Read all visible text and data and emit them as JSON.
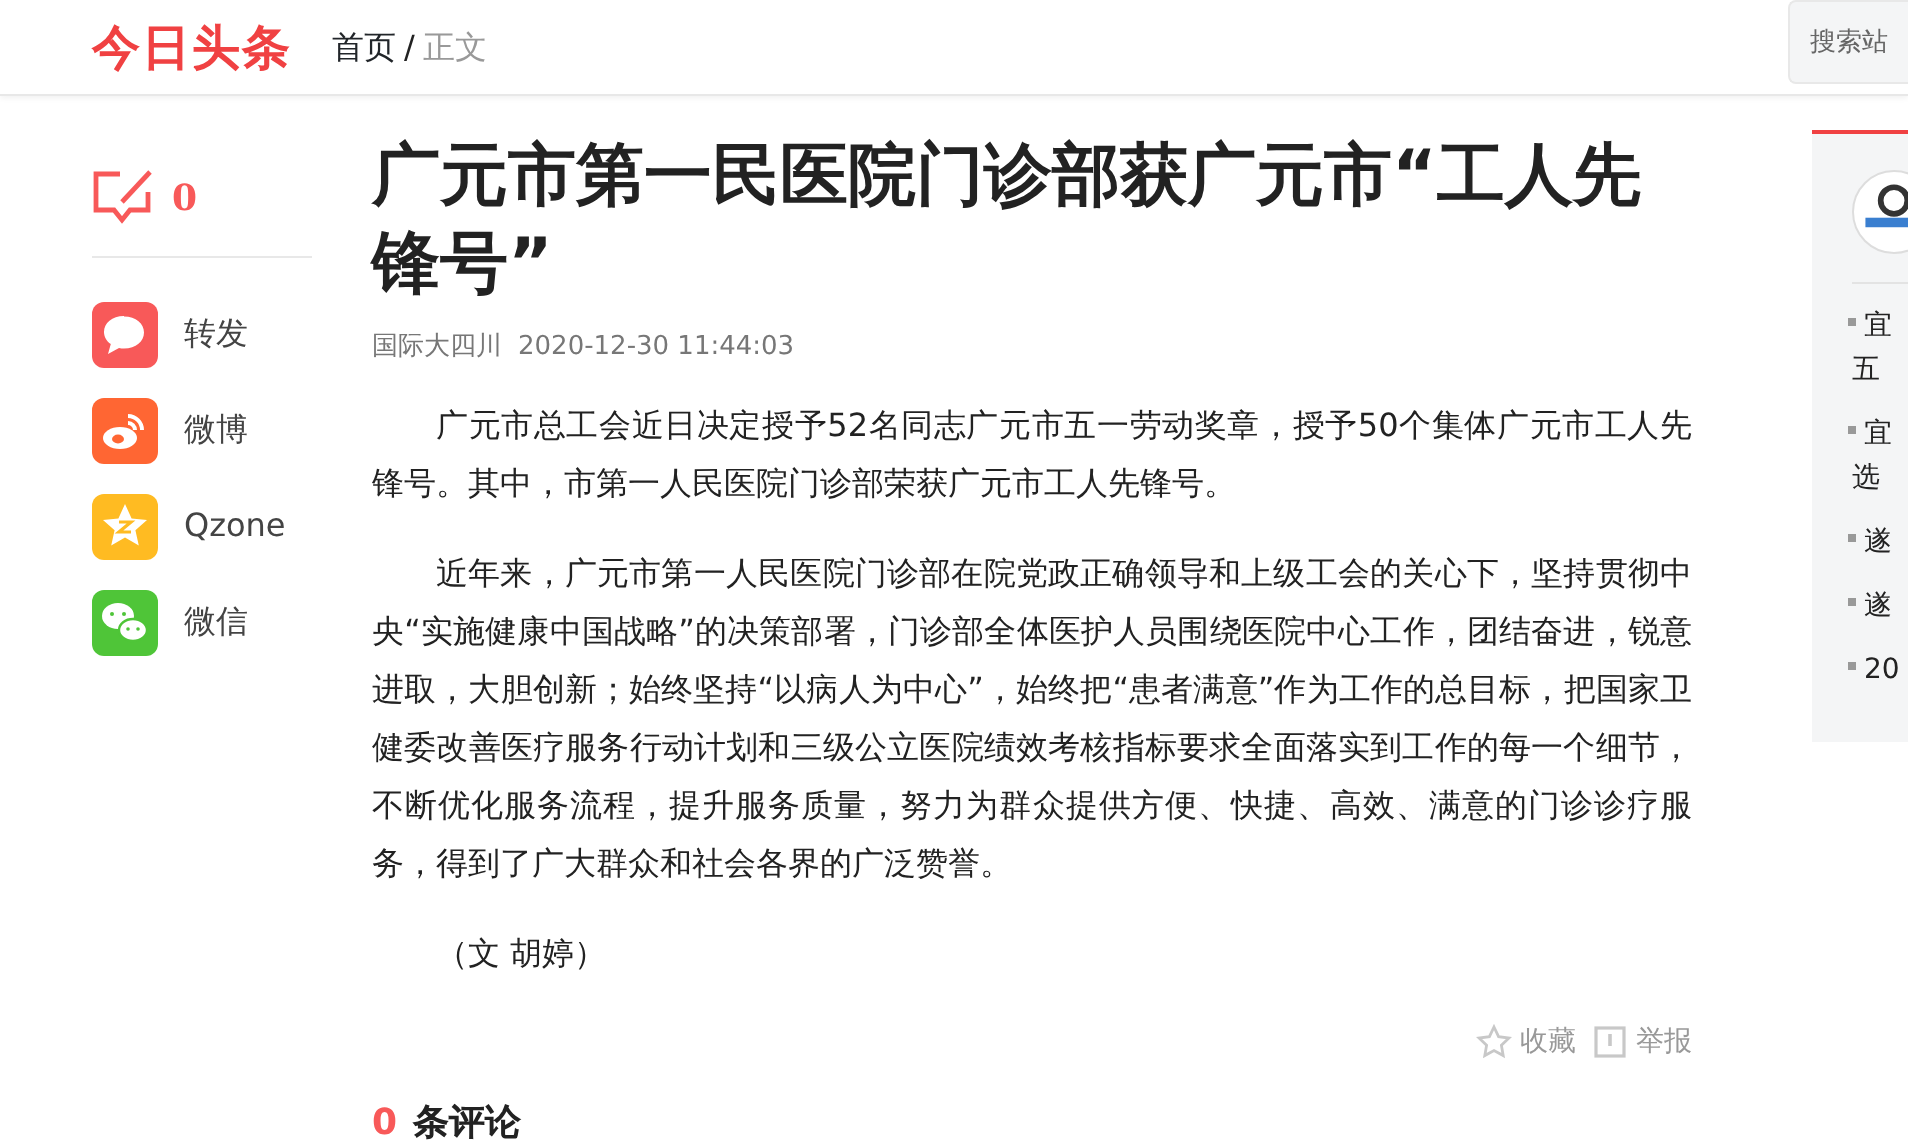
{
  "header": {
    "logo": "今日头条",
    "breadcrumb": [
      {
        "label": "首页",
        "current": false
      },
      {
        "label": "正文",
        "current": true
      }
    ],
    "separator": "/",
    "search": {
      "placeholder": "搜索站"
    }
  },
  "left_rail": {
    "comment_count": "0",
    "share": [
      {
        "kind": "repost",
        "label": "转发",
        "color": "#f85959"
      },
      {
        "kind": "weibo",
        "label": "微博",
        "color": "#ff6633"
      },
      {
        "kind": "qzone",
        "label": "Qzone",
        "color": "#ffbb22"
      },
      {
        "kind": "wechat",
        "label": "微信",
        "color": "#4fc538"
      }
    ]
  },
  "article": {
    "title": "广元市第一民医院门诊部获广元市“工人先锋号”",
    "source": "国际大四川",
    "time": "2020-12-30 11:44:03",
    "paragraphs": [
      "广元市总工会近日决定授予52名同志广元市五一劳动奖章，授予50个集体广元市工人先锋号。其中，市第一人民医院门诊部荣获广元市工人先锋号。",
      "近年来，广元市第一人民医院门诊部在院党政正确领导和上级工会的关心下，坚持贯彻中央“实施健康中国战略”的决策部署，门诊部全体医护人员围绕医院中心工作，团结奋进，锐意进取，大胆创新；始终坚持“以病人为中心”，始终把“患者满意”作为工作的总目标，把国家卫健委改善医疗服务行动计划和三级公立医院绩效考核指标要求全面落实到工作的每一个细节，不断优化服务流程，提升服务质量，努力为群众提供方便、快捷、高效、满意的门诊诊疗服务，得到了广大群众和社会各界的广泛赞誉。",
      "（文 胡婷）"
    ],
    "actions": [
      {
        "kind": "favorite",
        "label": "收藏"
      },
      {
        "kind": "report",
        "label": "举报"
      }
    ],
    "comments": {
      "count": "0",
      "label": "条评论"
    }
  },
  "sidebar": {
    "items": [
      {
        "lines": [
          "宜",
          "五"
        ]
      },
      {
        "lines": [
          "宜",
          "选"
        ]
      },
      {
        "lines": [
          "遂"
        ]
      },
      {
        "lines": [
          "遂"
        ]
      },
      {
        "lines": [
          "20"
        ]
      }
    ]
  }
}
